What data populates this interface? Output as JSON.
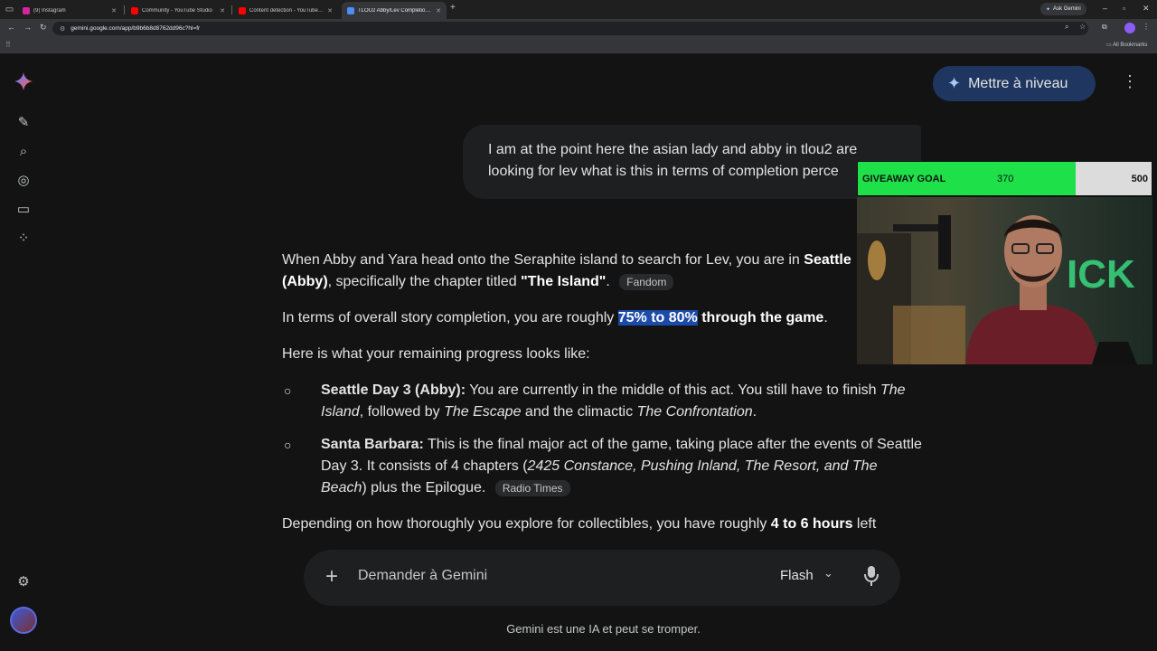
{
  "browser": {
    "tabs": [
      {
        "title": "(9) Instagram",
        "color": "#d6249f",
        "active": false
      },
      {
        "title": "Community - YouTube Studio",
        "color": "#ff0000",
        "active": false
      },
      {
        "title": "Content detection - YouTube St",
        "color": "#ff0000",
        "active": false
      },
      {
        "title": "TLOU2 Abby/Lev Completion Pr",
        "color": "#4c8df6",
        "active": true
      }
    ],
    "ask_gemini": "Ask Gemini",
    "url": "gemini.google.com/app/b9b6b8d8762dd96c?hl=fr",
    "all_bookmarks": "All Bookmarks"
  },
  "header": {
    "upgrade_label": "Mettre à niveau"
  },
  "conversation": {
    "user_message": "I am at the point here the asian lady and abby in tlou2 are looking for lev what is this in terms of completion perce",
    "p1_a": "When Abby and Yara head onto the Seraphite island to search for Lev, you are in ",
    "p1_b1": "Seattle",
    "p1_b2": "(Abby)",
    "p1_c": ", specifically the chapter titled ",
    "p1_d": "\"The Island\"",
    "p1_e": ".",
    "p1_source": "Fandom",
    "p2_a": "In terms of overall story completion, you are roughly ",
    "p2_hl": "75% to 80%",
    "p2_b": " through the game",
    "p2_c": ".",
    "p3": "Here is what your remaining progress looks like:",
    "b1_title": "Seattle Day 3 (Abby):",
    "b1_a": " You are currently in the middle of this act. You still have to finish ",
    "b1_i1": "The",
    "b1_i1b": "Island",
    "b1_b": ", followed by ",
    "b1_i2": "The Escape",
    "b1_c": " and the climactic ",
    "b1_i3": "The Confrontation",
    "b1_d": ".",
    "b2_title": "Santa Barbara:",
    "b2_a": " This is the final major act of the game, taking place after the events of Seattle Day 3. It consists of 4 chapters (",
    "b2_i": "2425 Constance, Pushing Inland, The Resort, and The Beach",
    "b2_b": ") plus the Epilogue.",
    "b2_source": "Radio Times",
    "p4_a": "Depending on how thoroughly you explore for collectibles, you have roughly ",
    "p4_b": "4 to 6 hours",
    "p4_c": " left"
  },
  "input": {
    "placeholder": "Demander à Gemini",
    "model": "Flash"
  },
  "disclaimer": "Gemini est une IA et peut se tromper.",
  "overlay": {
    "goal_label": "GIVEAWAY GOAL",
    "goal_current": "370",
    "goal_max": "500",
    "goal_fraction": 0.74,
    "webcam_sign": "ICK"
  },
  "colors": {
    "accent": "#a8c7fa",
    "upgrade_bg": "#1f3760",
    "highlight": "#1b4aa8",
    "goal_fill": "#1ee14a"
  },
  "icons": {
    "rail": [
      "new-chat-icon",
      "search-icon",
      "gems-icon",
      "library-icon",
      "apps-icon"
    ],
    "settings": "settings-icon"
  }
}
